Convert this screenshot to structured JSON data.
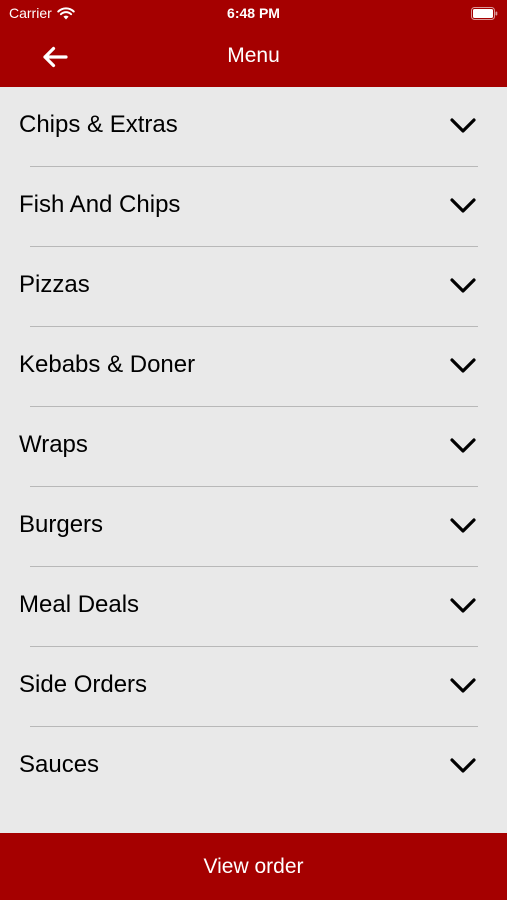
{
  "colors": {
    "brand": "#a50000",
    "background": "#e9e9e9",
    "divider": "#b8b8b8",
    "text": "#000000",
    "on_brand": "#ffffff"
  },
  "status_bar": {
    "carrier": "Carrier",
    "time": "6:48 PM",
    "icons": [
      "wifi-icon",
      "battery-icon"
    ]
  },
  "header": {
    "title": "Menu",
    "back_icon": "arrow-left-icon"
  },
  "menu": {
    "items": [
      {
        "label": "Chips & Extras",
        "icon": "chevron-down-icon"
      },
      {
        "label": "Fish And Chips",
        "icon": "chevron-down-icon"
      },
      {
        "label": "Pizzas",
        "icon": "chevron-down-icon"
      },
      {
        "label": "Kebabs & Doner",
        "icon": "chevron-down-icon"
      },
      {
        "label": "Wraps",
        "icon": "chevron-down-icon"
      },
      {
        "label": "Burgers",
        "icon": "chevron-down-icon"
      },
      {
        "label": "Meal Deals",
        "icon": "chevron-down-icon"
      },
      {
        "label": "Side Orders",
        "icon": "chevron-down-icon"
      },
      {
        "label": "Sauces",
        "icon": "chevron-down-icon"
      }
    ]
  },
  "footer": {
    "view_order_label": "View order"
  }
}
